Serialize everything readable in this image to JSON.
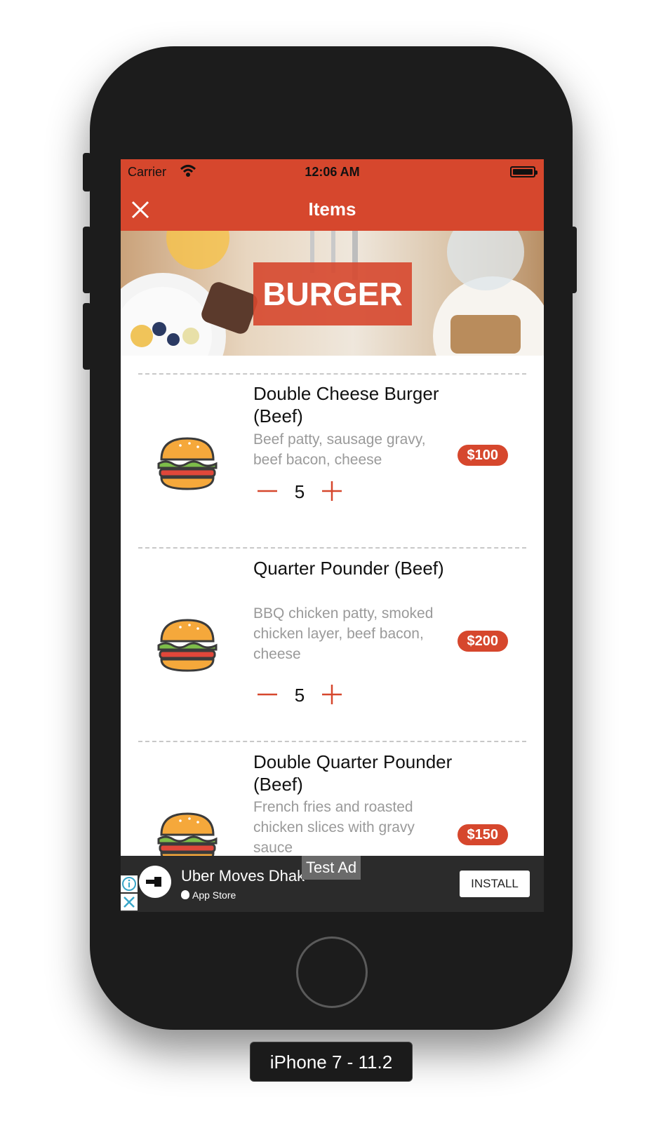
{
  "status_bar": {
    "carrier": "Carrier",
    "time": "12:06 AM"
  },
  "nav": {
    "title": "Items"
  },
  "hero": {
    "label": "BURGER"
  },
  "items": [
    {
      "name": "Double Cheese Burger (Beef)",
      "description": "Beef patty, sausage gravy, beef bacon, cheese",
      "price": "$100",
      "quantity": "5",
      "icon": "burger-icon"
    },
    {
      "name": "Quarter Pounder (Beef)",
      "description": "BBQ chicken patty, smoked chicken layer, beef bacon, cheese",
      "price": "$200",
      "quantity": "5",
      "icon": "burger-icon"
    },
    {
      "name": "Double Quarter Pounder (Beef)",
      "description": "French fries and roasted chicken slices with gravy sauce",
      "price": "$150",
      "icon": "burger-icon"
    }
  ],
  "ad": {
    "title": "Uber Moves Dhak",
    "store": "App Store",
    "test_label": "Test Ad",
    "install_label": "INSTALL"
  },
  "device_label": "iPhone 7 - 11.2",
  "colors": {
    "accent": "#d6472d",
    "device": "#1c1c1c"
  }
}
